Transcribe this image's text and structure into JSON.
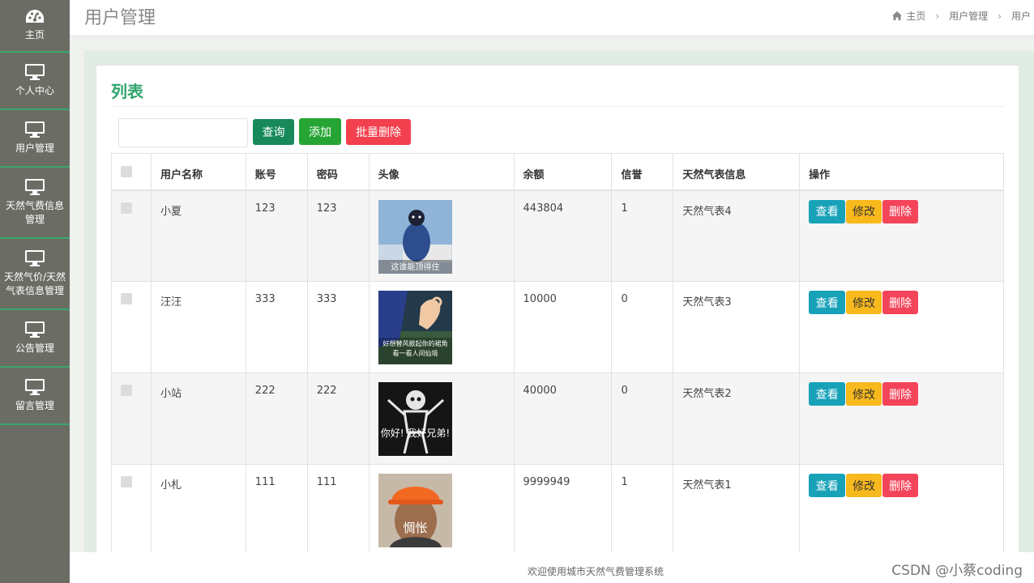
{
  "sidebar": {
    "items": [
      {
        "label": "主页",
        "icon": "dashboard-icon"
      },
      {
        "label": "个人中心",
        "icon": "monitor-icon"
      },
      {
        "label": "用户管理",
        "icon": "monitor-icon"
      },
      {
        "label": "天然气费信息\n管理",
        "icon": "monitor-icon"
      },
      {
        "label": "天然气价/天然\n气表信息管理",
        "icon": "monitor-icon"
      },
      {
        "label": "公告管理",
        "icon": "monitor-icon"
      },
      {
        "label": "留言管理",
        "icon": "monitor-icon"
      }
    ]
  },
  "header": {
    "title": "用户管理",
    "breadcrumb": [
      "主页",
      "用户管理",
      "用户"
    ]
  },
  "card": {
    "title": "列表",
    "search_value": "",
    "buttons": {
      "query": "查询",
      "add": "添加",
      "bulk_delete": "批量删除"
    }
  },
  "table": {
    "columns": [
      "",
      "用户名称",
      "账号",
      "密码",
      "头像",
      "余额",
      "信誉",
      "天然气表信息",
      "操作"
    ],
    "rows": [
      {
        "name": "小夏",
        "account": "123",
        "password": "123",
        "avatar_caption": "这谁能顶得住",
        "balance": "443804",
        "credit": "1",
        "meter": "天然气表4"
      },
      {
        "name": "汪汪",
        "account": "333",
        "password": "333",
        "avatar_caption": "好想替风掀起你的裙角 看一看人间仙境",
        "balance": "10000",
        "credit": "0",
        "meter": "天然气表3"
      },
      {
        "name": "小站",
        "account": "222",
        "password": "222",
        "avatar_caption": "你好! 我好兄弟!",
        "balance": "40000",
        "credit": "0",
        "meter": "天然气表2"
      },
      {
        "name": "小札",
        "account": "111",
        "password": "111",
        "avatar_caption": "惆怅",
        "balance": "9999949",
        "credit": "1",
        "meter": "天然气表1"
      }
    ],
    "actions": {
      "view": "查看",
      "edit": "修改",
      "delete": "删除"
    }
  },
  "footer": {
    "text": "欢迎使用城市天然气费管理系统"
  },
  "watermark": "CSDN @小蔡coding",
  "colors": {
    "sidebar": "#6b6d65",
    "accent": "#2fa36b",
    "query": "#17895b",
    "add": "#26a535",
    "danger": "#f2404e",
    "view": "#17a2b8",
    "edit": "#f8b91c"
  }
}
